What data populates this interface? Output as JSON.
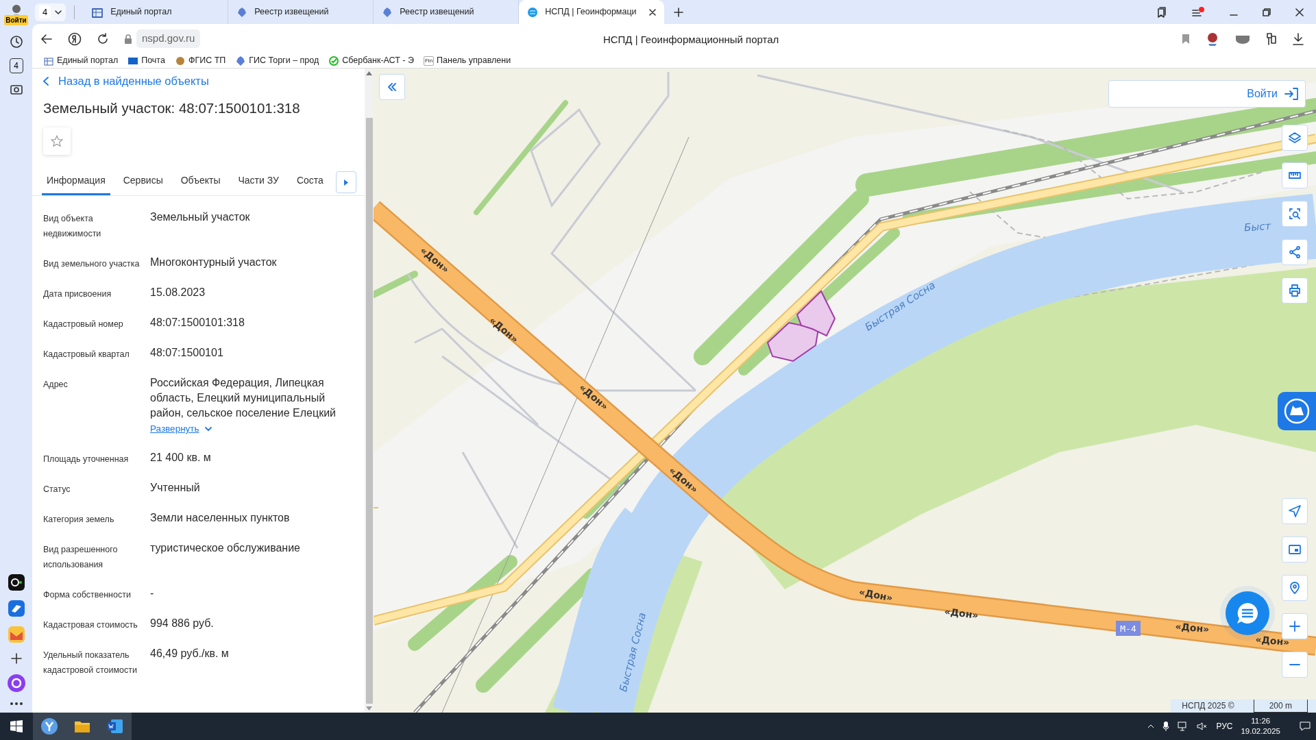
{
  "browser": {
    "profile_label": "Войти",
    "tab_count": "4",
    "sidebar_badge": "4",
    "url": "nspd.gov.ru",
    "page_title": "НСПД | Геоинформационный портал",
    "tabs": [
      {
        "title": "Единый портал",
        "selected": false
      },
      {
        "title": "Реестр извещений",
        "selected": false
      },
      {
        "title": "Реестр извещений",
        "selected": false
      },
      {
        "title": "НСПД | Геоинформаци",
        "selected": true
      }
    ],
    "bookmarks": [
      {
        "label": "Единый портал"
      },
      {
        "label": "Почта"
      },
      {
        "label": "ФГИС ТП"
      },
      {
        "label": "ГИС Торги – прод"
      },
      {
        "label": "Сбербанк-АСТ - Э"
      },
      {
        "label": "Панель управлени",
        "badge": "Fin"
      }
    ]
  },
  "panel": {
    "back_link": "Назад в найденные объекты",
    "title": "Земельный участок: 48:07:1500101:318",
    "favorite": false,
    "tabs": [
      {
        "label": "Информация",
        "selected": true
      },
      {
        "label": "Сервисы",
        "selected": false
      },
      {
        "label": "Объекты",
        "selected": false
      },
      {
        "label": "Части ЗУ",
        "selected": false
      },
      {
        "label": "Соста",
        "selected": false
      }
    ],
    "fields": [
      {
        "label": "Вид объекта недвижимости",
        "value": "Земельный участок"
      },
      {
        "label": "Вид земельного участка",
        "value": "Многоконтурный участок"
      },
      {
        "label": "Дата присвоения",
        "value": "15.08.2023"
      },
      {
        "label": "Кадастровый номер",
        "value": "48:07:1500101:318"
      },
      {
        "label": "Кадастровый квартал",
        "value": "48:07:1500101"
      },
      {
        "label": "Адрес",
        "value": "Российская Федерация, Липецкая область, Елецкий муниципальный район, сельское поселение Елецкий",
        "expand_link": "Развернуть"
      },
      {
        "label": "Площадь уточненная",
        "value": "21 400 кв. м"
      },
      {
        "label": "Статус",
        "value": "Учтенный"
      },
      {
        "label": "Категория земель",
        "value": "Земли населенных пунктов"
      },
      {
        "label": "Вид разрешенного использования",
        "value": "туристическое обслуживание"
      },
      {
        "label": "Форма собственности",
        "value": "-"
      },
      {
        "label": "Кадастровая стоимость",
        "value": "994 886 руб."
      },
      {
        "label": "Удельный показатель кадастровой стоимости",
        "value": "46,49 руб./кв. м"
      }
    ]
  },
  "map": {
    "login": "Войти",
    "attribution": "НСПД 2025 ©",
    "scale": "200 m",
    "labels": [
      {
        "text": "«Дон»",
        "kind": "road"
      },
      {
        "text": "«Дон»",
        "kind": "road"
      },
      {
        "text": "«Дон»",
        "kind": "road"
      },
      {
        "text": "«Дон»",
        "kind": "road"
      },
      {
        "text": "«Дон»",
        "kind": "road"
      },
      {
        "text": "«Дон»",
        "kind": "road"
      },
      {
        "text": "«Дон»",
        "kind": "road"
      },
      {
        "text": "«Дон»",
        "kind": "road"
      },
      {
        "text": "М-4",
        "kind": "shield"
      },
      {
        "text": "Быстрая Сосна",
        "kind": "river"
      },
      {
        "text": "Быстрая Сосна",
        "kind": "river"
      },
      {
        "text": "Быст",
        "kind": "river"
      }
    ]
  },
  "taskbar": {
    "language": "РУС",
    "time": "11:26",
    "date": "19.02.2025"
  }
}
